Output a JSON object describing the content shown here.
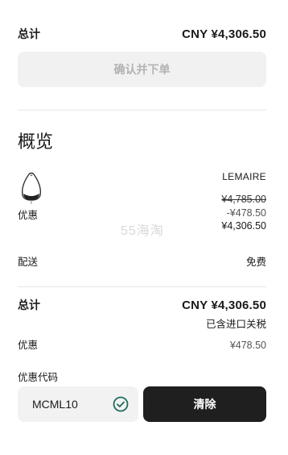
{
  "summary_top": {
    "total_label": "总计",
    "total_value": "CNY ¥4,306.50",
    "confirm_button": "确认并下单"
  },
  "overview": {
    "title": "概览",
    "product": {
      "brand": "LEMAIRE",
      "discount_label": "优惠",
      "original_price": "¥4,785.00",
      "discount_amount": "-¥478.50",
      "final_price": "¥4,306.50"
    },
    "watermark": "55海淘",
    "shipping_label": "配送",
    "shipping_value": "免费"
  },
  "summary_bottom": {
    "total_label": "总计",
    "total_value": "CNY ¥4,306.50",
    "tax_note": "已含进口关税",
    "discount_label": "优惠",
    "discount_value": "¥478.50"
  },
  "promo": {
    "label": "优惠代码",
    "code": "MCML10",
    "status_icon": "check-circle-icon",
    "clear_button": "清除"
  },
  "colors": {
    "accent_check": "#1f6b5a",
    "dark_button": "#1f1f1f",
    "disabled_button": "#f1f1f1"
  }
}
